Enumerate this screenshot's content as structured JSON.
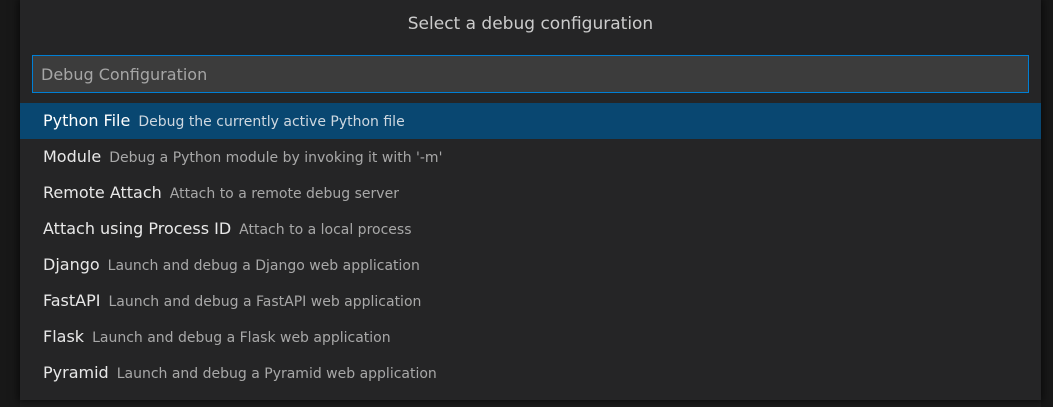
{
  "quick_pick": {
    "title": "Select a debug configuration",
    "input": {
      "value": "",
      "placeholder": "Debug Configuration"
    },
    "selected_index": 0,
    "items": [
      {
        "label": "Python File",
        "description": "Debug the currently active Python file"
      },
      {
        "label": "Module",
        "description": "Debug a Python module by invoking it with '-m'"
      },
      {
        "label": "Remote Attach",
        "description": "Attach to a remote debug server"
      },
      {
        "label": "Attach using Process ID",
        "description": "Attach to a local process"
      },
      {
        "label": "Django",
        "description": "Launch and debug a Django web application"
      },
      {
        "label": "FastAPI",
        "description": "Launch and debug a FastAPI web application"
      },
      {
        "label": "Flask",
        "description": "Launch and debug a Flask web application"
      },
      {
        "label": "Pyramid",
        "description": "Launch and debug a Pyramid web application"
      }
    ]
  },
  "colors": {
    "widget_background": "#252526",
    "input_background": "#3c3c3c",
    "focus_border": "#007fd4",
    "selection_background": "#094771"
  }
}
